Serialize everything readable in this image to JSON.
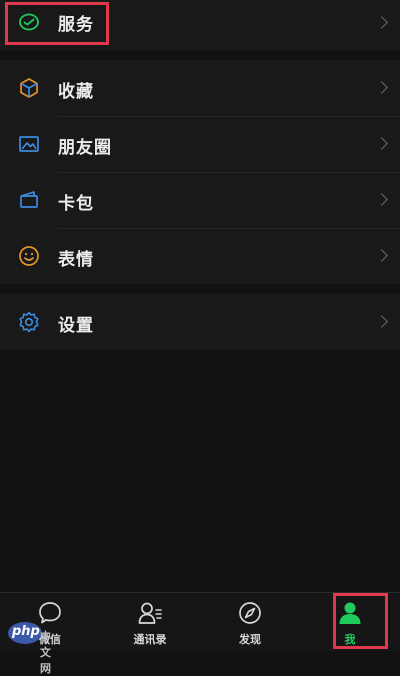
{
  "colors": {
    "background": "#111111",
    "row_background": "#191919",
    "accent_green": "#1ecb5c",
    "highlight_red": "#e0394b"
  },
  "menu": {
    "service": {
      "label": "服务",
      "icon": "wechat-pay-icon"
    },
    "favorites": {
      "label": "收藏",
      "icon": "cube-icon"
    },
    "moments": {
      "label": "朋友圈",
      "icon": "picture-icon"
    },
    "cards": {
      "label": "卡包",
      "icon": "card-wallet-icon"
    },
    "stickers": {
      "label": "表情",
      "icon": "smiley-icon"
    },
    "settings": {
      "label": "设置",
      "icon": "gear-icon"
    }
  },
  "tabbar": {
    "tabs": [
      {
        "label": "微信",
        "icon": "chat-bubble-icon"
      },
      {
        "label": "通讯录",
        "icon": "contacts-icon"
      },
      {
        "label": "发现",
        "icon": "compass-icon"
      },
      {
        "label": "我",
        "icon": "person-icon",
        "active": true
      }
    ]
  },
  "watermark": {
    "logo": "php",
    "site": "中文网"
  }
}
